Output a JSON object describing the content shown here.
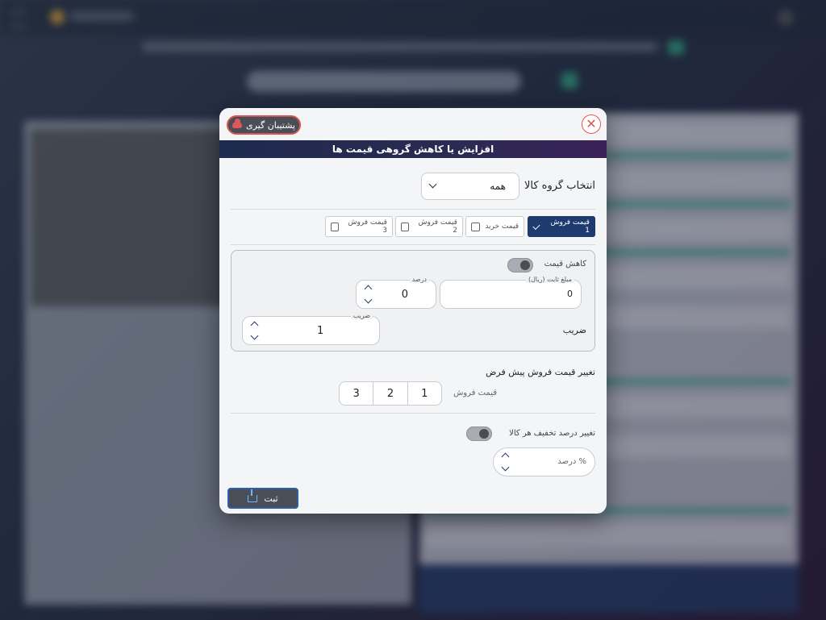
{
  "modal": {
    "backup_label": "پشتیبان گیری",
    "close_glyph": "✕",
    "title": "افزایش یا کاهش گروهی قیمت ها",
    "group_select": {
      "label": "انتخاب گروه کالا",
      "value": "همه"
    },
    "price_tabs": [
      {
        "label": "قیمت فروش 1",
        "checked": true
      },
      {
        "label": "قیمت خرید",
        "checked": false
      },
      {
        "label": "قیمت فروش 2",
        "checked": false
      },
      {
        "label": "قیمت فروش 3",
        "checked": false
      }
    ],
    "decrease_panel": {
      "toggle_label": "کاهش قیمت",
      "fixed_amount": {
        "label": "مبلغ ثابت (ریال)",
        "value": "0"
      },
      "percent": {
        "label": "درصد",
        "value": "0"
      },
      "coefficient_label": "ضریب",
      "coefficient": {
        "label": "ضریب",
        "value": "1"
      }
    },
    "default_sale": {
      "heading": "تغییر قیمت فروش پیش فرض",
      "label": "قیمت فروش",
      "options": [
        "1",
        "2",
        "3"
      ]
    },
    "discount": {
      "toggle_label": "تغییر درصد تخفیف هر کالا",
      "placeholder": "درصد %"
    },
    "submit_label": "ثبت"
  }
}
